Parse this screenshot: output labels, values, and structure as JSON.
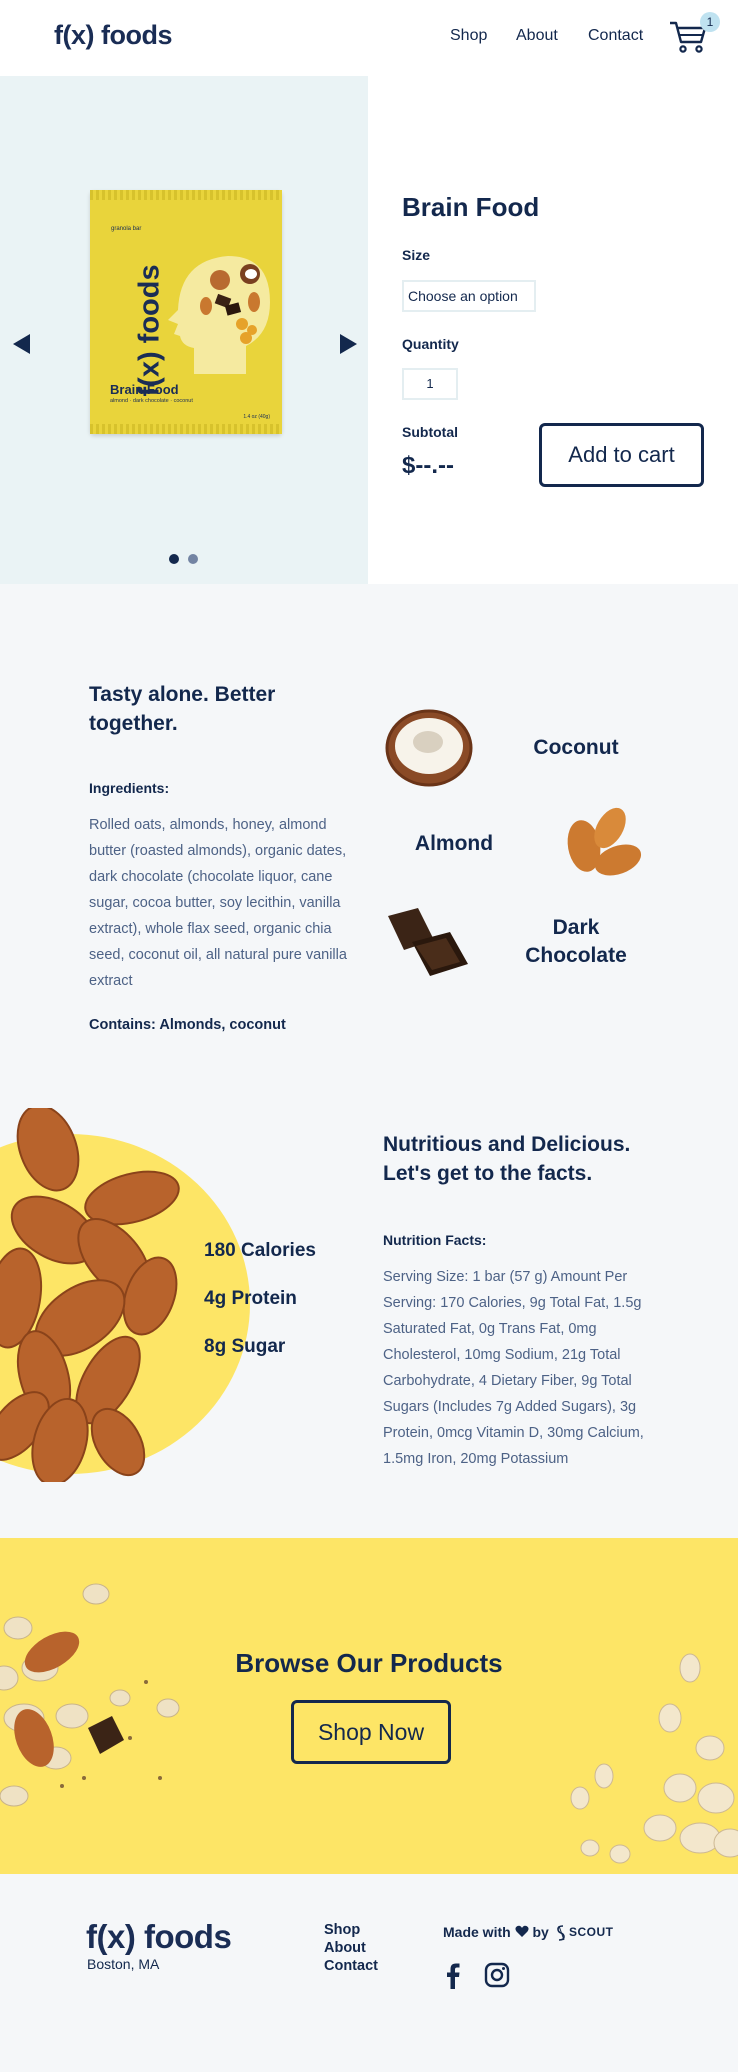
{
  "header": {
    "logo": "f(x) foods",
    "nav": [
      "Shop",
      "About",
      "Contact"
    ],
    "cart_count": "1"
  },
  "product": {
    "package": {
      "small_label": "granola bar",
      "brand": "f(x) foods",
      "name": "Brain Food",
      "ingredients_line": "almond · dark chocolate · coconut",
      "weight": "1.4 oz (40g)"
    },
    "title": "Brain Food",
    "size_label": "Size",
    "size_value": "Choose an option",
    "quantity_label": "Quantity",
    "quantity_value": "1",
    "subtotal_label": "Subtotal",
    "subtotal_value": "$--.--",
    "add_to_cart": "Add to cart",
    "carousel_active_index": 0
  },
  "ingredients_section": {
    "heading": "Tasty alone. Better together.",
    "subheading": "Ingredients:",
    "text": "Rolled oats, almonds, honey, almond butter (roasted almonds), organic dates, dark chocolate (chocolate liquor, cane sugar, cocoa butter, soy lecithin, vanilla extract), whole flax seed, organic chia seed, coconut oil, all natural pure vanilla extract",
    "contains": "Contains: Almonds, coconut",
    "items": [
      "Coconut",
      "Almond",
      "Dark Chocolate"
    ]
  },
  "nutrition_section": {
    "stats": [
      "180 Calories",
      "4g Protein",
      "8g Sugar"
    ],
    "heading": "Nutritious and Delicious. Let's get to the facts.",
    "subheading": "Nutrition Facts:",
    "text": "Serving Size: 1 bar (57 g) Amount Per Serving: 170 Calories, 9g Total Fat, 1.5g Saturated Fat, 0g Trans Fat, 0mg Cholesterol, 10mg Sodium, 21g Total Carbohydrate, 4 Dietary Fiber, 9g Total Sugars (Includes 7g Added Sugars), 3g Protein, 0mcg Vitamin D, 30mg Calcium, 1.5mg Iron, 20mg Potassium"
  },
  "banner": {
    "heading": "Browse Our Products",
    "button": "Shop Now"
  },
  "footer": {
    "logo": "f(x) foods",
    "city": "Boston, MA",
    "links": [
      "Shop",
      "About",
      "Contact"
    ],
    "made_with": "Made with",
    "by": "by",
    "scout": "SCOUT"
  },
  "colors": {
    "navy": "#13284d",
    "yellow": "#fde566",
    "light_blue": "#eaf3f5",
    "body_text": "#4d6286"
  },
  "icons": [
    "cart-icon",
    "arrow-left-icon",
    "arrow-right-icon",
    "heart-icon",
    "scout-icon",
    "facebook-icon",
    "instagram-icon"
  ]
}
